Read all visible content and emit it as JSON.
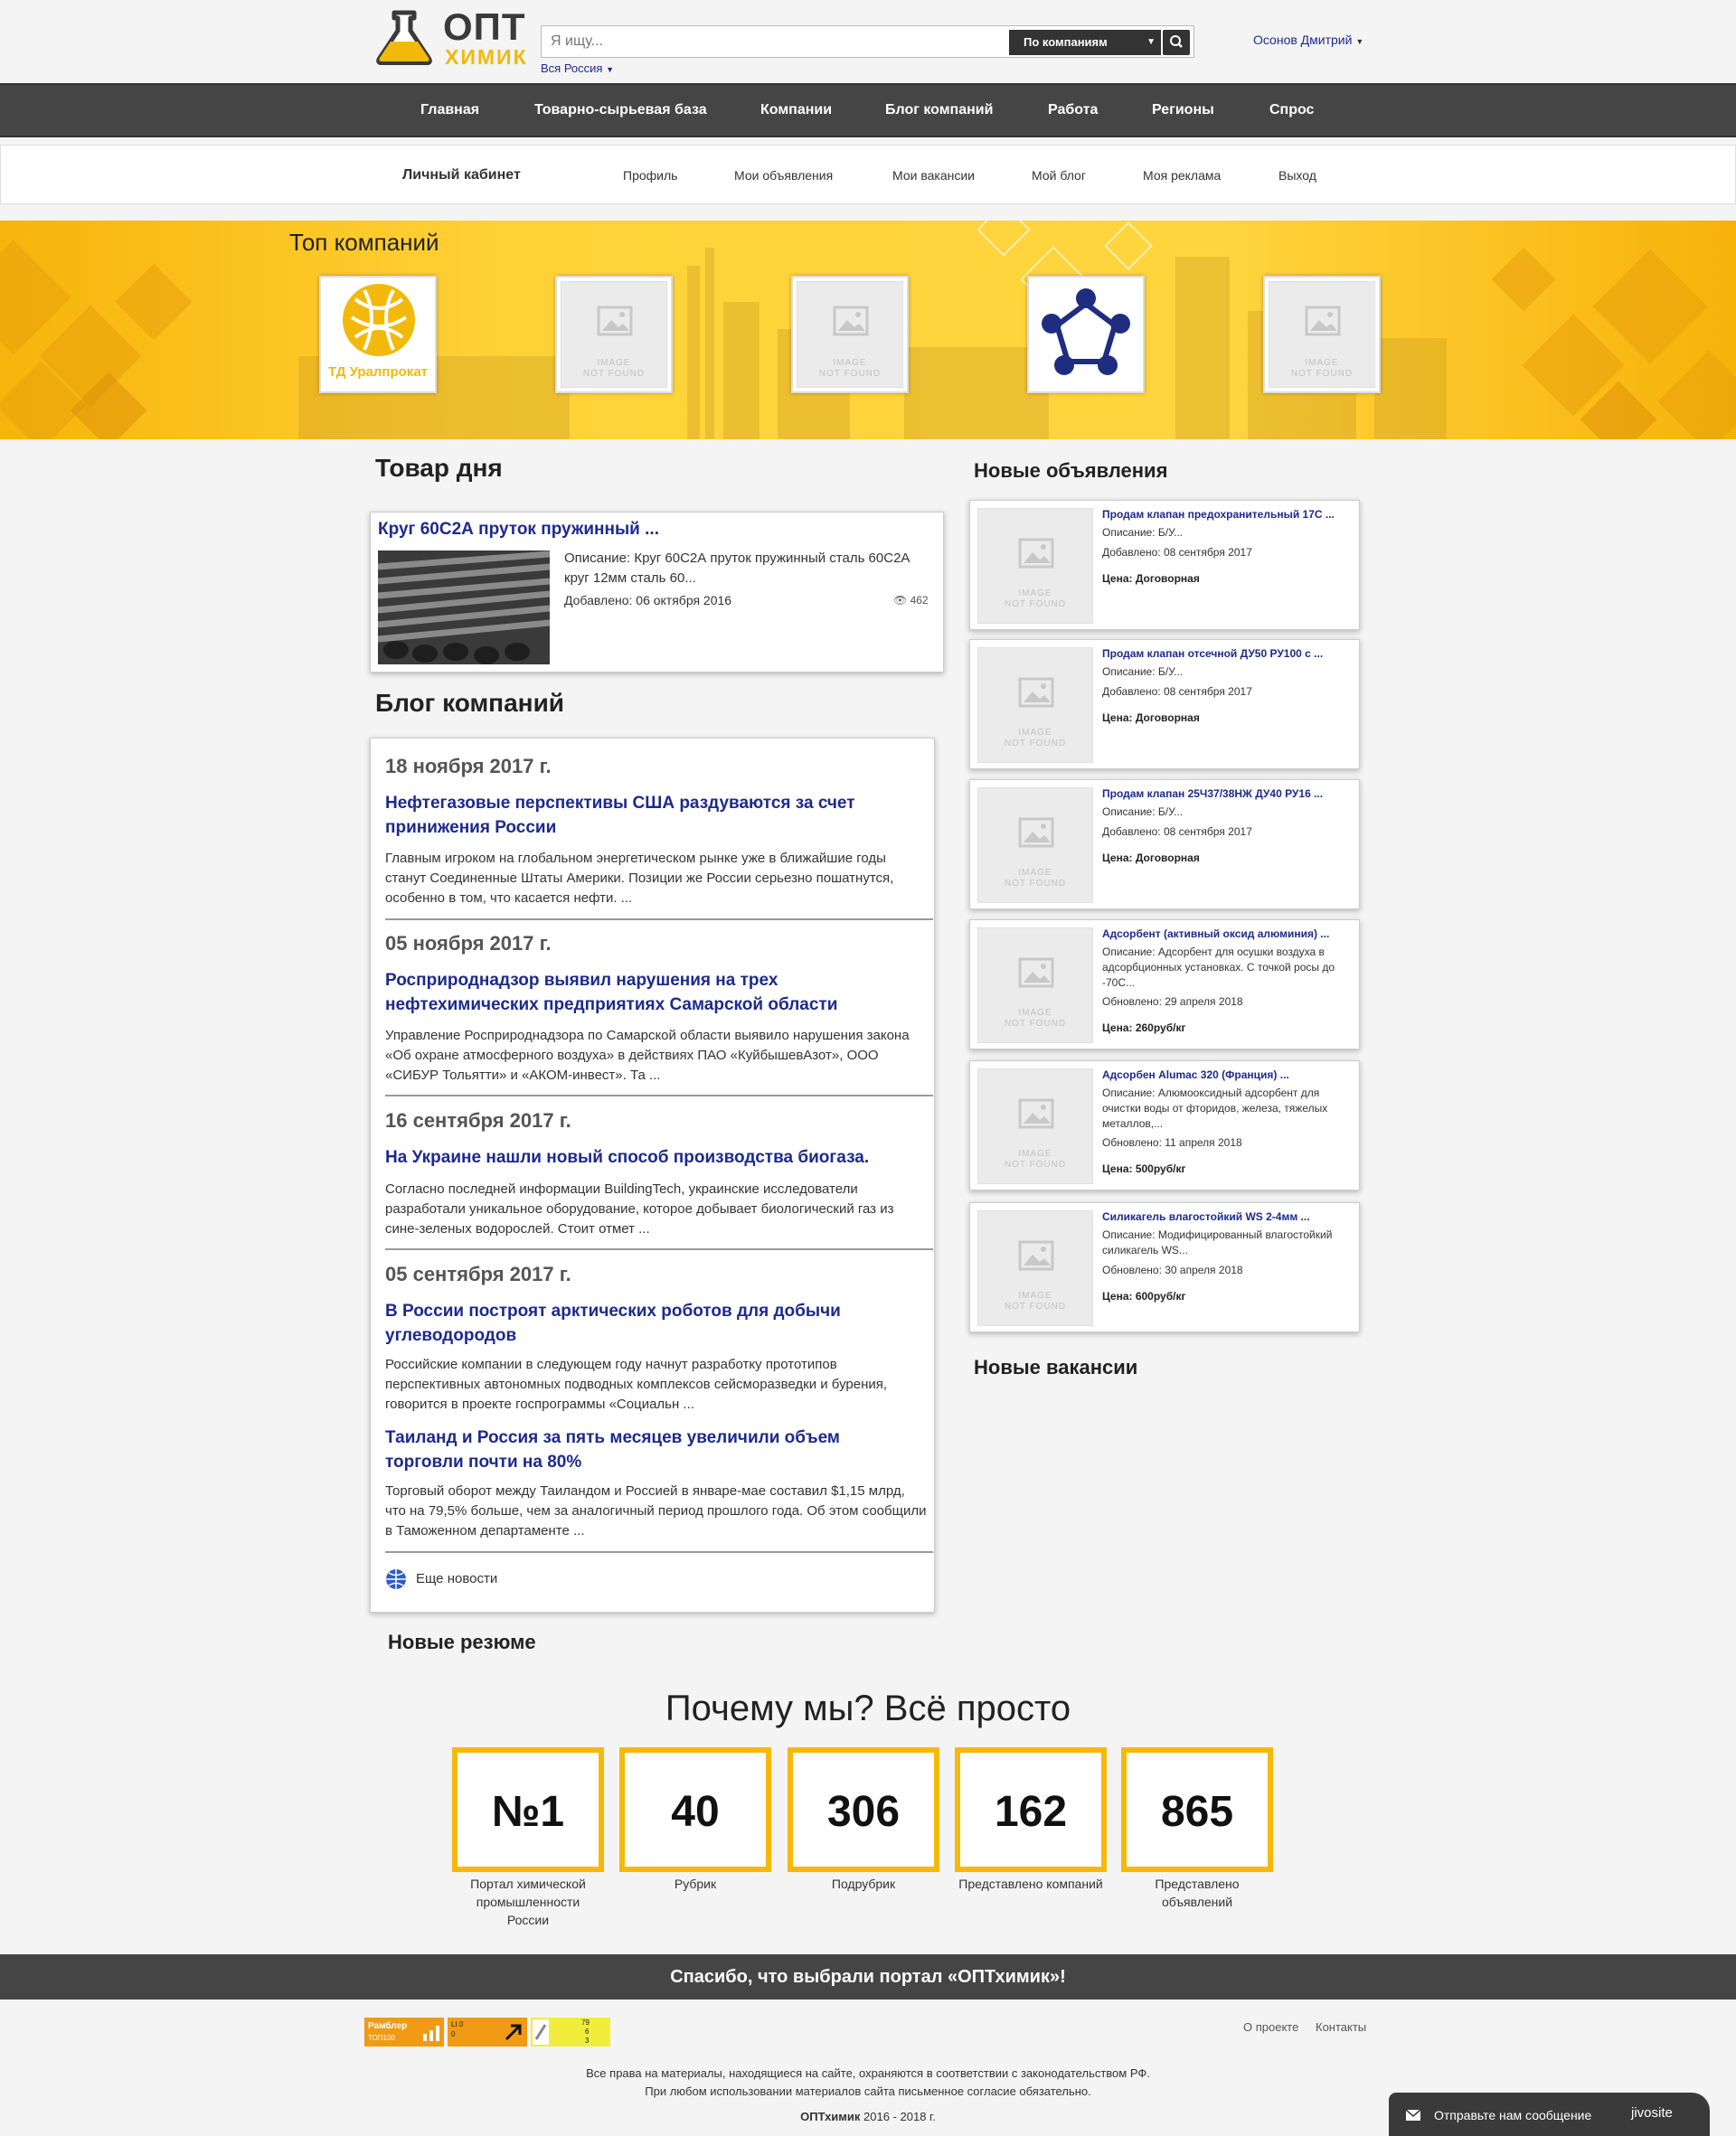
{
  "header": {
    "logo_top": "ОПТ",
    "logo_bottom": "ХИМИК",
    "search_placeholder": "Я ищу...",
    "search_mode": "По компаниям",
    "region": "Вся Россия",
    "user": "Осонов Дмитрий"
  },
  "main_nav": [
    "Главная",
    "Товарно-сырьевая база",
    "Компании",
    "Блог компаний",
    "Работа",
    "Регионы",
    "Спрос"
  ],
  "sub_nav": {
    "title": "Личный кабинет",
    "items": [
      "Профиль",
      "Мои объявления",
      "Мои вакансии",
      "Мой блог",
      "Моя реклама",
      "Выход"
    ]
  },
  "top_companies": {
    "title": "Топ компаний",
    "companies": [
      {
        "type": "logo",
        "caption": "ТД Уралпрокат"
      },
      {
        "type": "placeholder"
      },
      {
        "type": "placeholder"
      },
      {
        "type": "logo"
      },
      {
        "type": "placeholder"
      }
    ],
    "placeholder_line1": "IMAGE",
    "placeholder_line2": "NOT FOUND"
  },
  "product_of_day": {
    "heading": "Товар дня",
    "title": "Круг 60С2А пруток пружинный ...",
    "description": "Описание: Круг 60С2А пруток пружинный сталь 60С2А круг 12мм сталь 60...",
    "added": "Добавлено: 06 октября 2016",
    "views": "462"
  },
  "blog": {
    "heading": "Блог компаний",
    "groups": [
      {
        "date": "18 ноября 2017 г.",
        "posts": [
          {
            "title": "Нефтегазовые перспективы США раздуваются за счет принижения России",
            "text": "Главным игроком на глобальном энергетическом рынке уже в ближайшие годы станут Соединенные Штаты Америки. Позиции же России серьезно пошатнутся, особенно в том, что касается нефти. ..."
          }
        ]
      },
      {
        "date": "05 ноября 2017 г.",
        "posts": [
          {
            "title": "Росприроднадзор выявил нарушения на трех нефтехимических предприятиях Самарской области",
            "text": "Управление Росприроднадзора по Самарской области выявило нарушения закона «Об охране атмосферного воздуха» в действиях ПАО «КуйбышевАзот», ООО «СИБУР Тольятти» и «АКОМ-инвест». Та ..."
          }
        ]
      },
      {
        "date": "16 сентября 2017 г.",
        "posts": [
          {
            "title": "На Украине нашли новый способ производства биогаза.",
            "text": "Согласно последней информации BuildingTech, украинские исследователи разработали уникальное оборудование, которое добывает биологический газ из сине-зеленых водорослей. Стоит отмет ..."
          }
        ]
      },
      {
        "date": "05 сентября 2017 г.",
        "posts": [
          {
            "title": "В России построят арктических роботов для добычи углеводородов",
            "text": "Российские компании в следующем году начнут разработку прототипов перспективных автономных подводных комплексов сейсморазведки и бурения, говорится в проекте госпрограммы «Социальн ..."
          },
          {
            "title": "Таиланд и Россия за пять месяцев увеличили объем торговли почти на 80%",
            "text": "Торговый оборот между Таиландом и Россией в январе-мае составил $1,15 млрд, что на 79,5% больше, чем за аналогичный период прошлого года. Об этом сообщили в Таможенном департаменте ..."
          }
        ]
      }
    ],
    "more": "Еще новости"
  },
  "new_resumes": "Новые резюме",
  "new_ads": {
    "heading": "Новые объявления",
    "items": [
      {
        "title": "Продам клапан предохранительный 17С ...",
        "desc": "Описание: Б/У...",
        "date": "Добавлено: 08 сентября 2017",
        "price": "Цена: Договорная"
      },
      {
        "title": "Продам клапан отсечной ДУ50 РУ100 с ...",
        "desc": "Описание: Б/У...",
        "date": "Добавлено: 08 сентября 2017",
        "price": "Цена: Договорная"
      },
      {
        "title": "Продам клапан 25Ч37/38НЖ ДУ40 РУ16 ...",
        "desc": "Описание: Б/У...",
        "date": "Добавлено: 08 сентября 2017",
        "price": "Цена: Договорная"
      },
      {
        "title": "Адсорбент (активный оксид алюминия) ...",
        "desc": "Описание: Адсорбент для осушки воздуха в адсорбционных установках. С точкой росы до -70С...",
        "date": "Обновлено: 29 апреля 2018",
        "price": "Цена: 260руб/кг"
      },
      {
        "title": "Адсорбен Alumac 320 (Франция) ...",
        "desc": "Описание: Алюмооксидный адсорбент для очистки воды от фторидов, железа, тяжелых металлов,...",
        "date": "Обновлено: 11 апреля 2018",
        "price": "Цена: 500руб/кг"
      },
      {
        "title": "Силикагель влагостойкий WS 2-4мм ...",
        "desc": "Описание: Модифицированный влагостойкий силикагель WS...",
        "date": "Обновлено: 30 апреля 2018",
        "price": "Цена: 600руб/кг"
      }
    ]
  },
  "new_vacancies": "Новые вакансии",
  "why_us": {
    "heading": "Почему мы? Всё просто",
    "stats": [
      {
        "value": "№1",
        "label": "Портал химической промышленности России"
      },
      {
        "value": "40",
        "label": "Рубрик"
      },
      {
        "value": "306",
        "label": "Подрубрик"
      },
      {
        "value": "162",
        "label": "Представлено компаний"
      },
      {
        "value": "865",
        "label": "Представлено объявлений"
      }
    ]
  },
  "thanks": "Спасибо, что выбрали портал «ОПТхимик»!",
  "footer": {
    "links": [
      "О проекте",
      "Контакты"
    ],
    "rights_line1": "Все права на материалы, находящиеся на сайте, охраняются в соответствии с законодательством РФ.",
    "rights_line2": "При любом использовании материалов сайта письменное согласие обязательно.",
    "brand": "ОПТхимик",
    "years": "2016 - 2018 г.",
    "counter1_line1": "Рамблер",
    "counter1_line2": "ТОП100",
    "counter2_line1": "LI 0",
    "counter2_line2": "0",
    "counter3_lines": [
      "79",
      "6",
      "3"
    ]
  },
  "chat": {
    "label": "Отправьте нам сообщение",
    "brand": "jivosite"
  },
  "colors": {
    "accent": "#f5b90c",
    "link": "#1d2a8c",
    "nav": "#454545"
  }
}
